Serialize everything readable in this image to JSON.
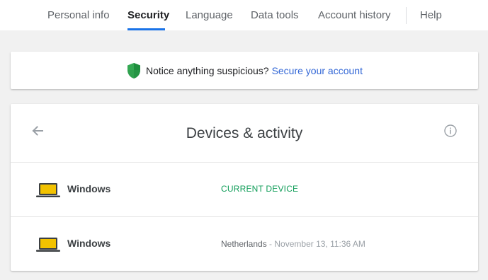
{
  "nav": {
    "tabs": [
      {
        "label": "Personal info"
      },
      {
        "label": "Security"
      },
      {
        "label": "Language"
      },
      {
        "label": "Data tools"
      },
      {
        "label": "Account history"
      },
      {
        "label": "Help"
      }
    ],
    "active_tab": "Security"
  },
  "notice": {
    "text": "Notice anything suspicious?",
    "link": "Secure your account",
    "icon": "shield-icon"
  },
  "devices_card": {
    "title": "Devices & activity",
    "icons": [
      "arrow-back-icon",
      "info-icon"
    ],
    "devices": [
      {
        "name": "Windows",
        "status": "CURRENT DEVICE",
        "icon": "laptop-icon"
      },
      {
        "name": "Windows",
        "location": "Netherlands",
        "separator": " - ",
        "time": "November 13, 11:36 AM",
        "icon": "laptop-icon"
      }
    ]
  },
  "colors": {
    "accent_blue": "#1a73e8",
    "link_blue": "#3367d6",
    "current_green": "#0f9d58",
    "laptop_yellow": "#f2c200"
  }
}
